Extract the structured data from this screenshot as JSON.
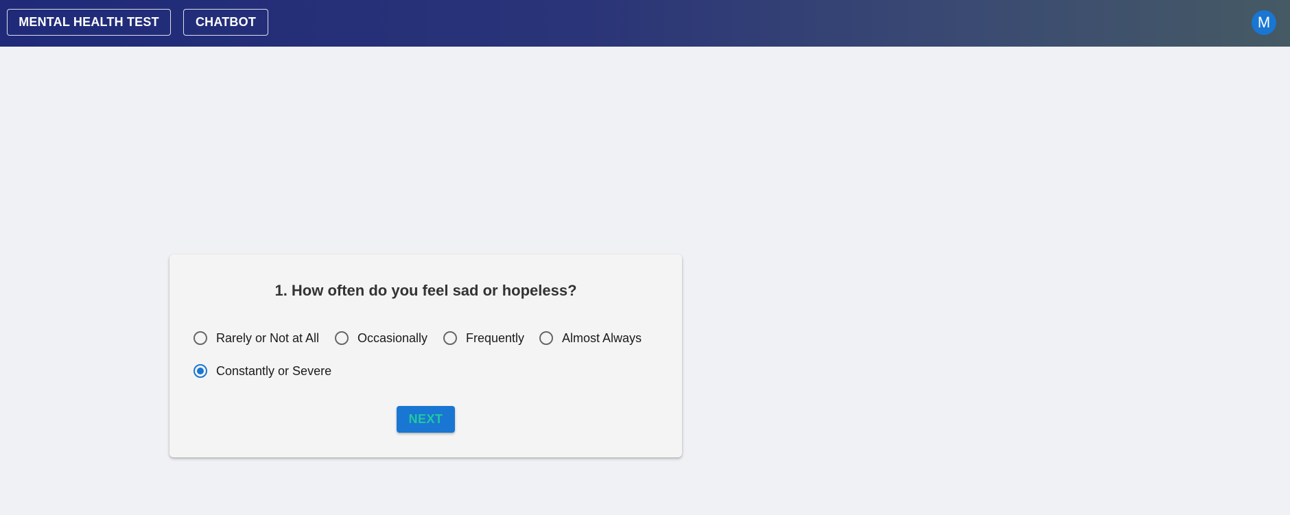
{
  "header": {
    "nav": [
      {
        "label": "MENTAL HEALTH TEST"
      },
      {
        "label": "CHATBOT"
      }
    ],
    "avatar_initial": "M"
  },
  "quiz": {
    "question": "1. How often do you feel sad or hopeless?",
    "options": [
      {
        "label": "Rarely or Not at All",
        "selected": false
      },
      {
        "label": "Occasionally",
        "selected": false
      },
      {
        "label": "Frequently",
        "selected": false
      },
      {
        "label": "Almost Always",
        "selected": false
      },
      {
        "label": "Constantly or Severe",
        "selected": true
      }
    ],
    "next_label": "NEXT"
  },
  "colors": {
    "accent": "#1976d2",
    "next_text": "#1fc9a0",
    "header_gradient_start": "#1f2a79",
    "header_gradient_end": "#455a64",
    "background": "#f0f1f4"
  }
}
